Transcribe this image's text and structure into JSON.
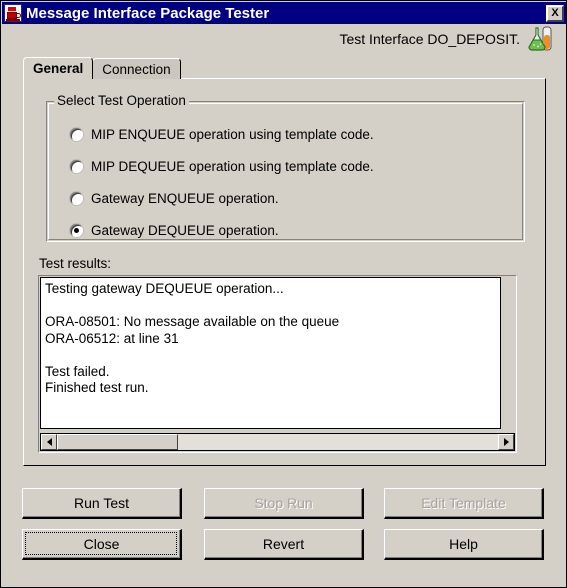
{
  "window": {
    "title": "Message Interface Package Tester",
    "icon": "java-coffee-cup-icon",
    "close_label": "X"
  },
  "header": {
    "interface_label": "Test Interface DO_DEPOSIT.",
    "icon": "flask-test-tube-icon"
  },
  "tabs": [
    {
      "label": "General",
      "selected": true
    },
    {
      "label": "Connection",
      "selected": false
    }
  ],
  "group": {
    "title": "Select Test Operation",
    "options": [
      {
        "label": "MIP ENQUEUE operation using template code.",
        "checked": false
      },
      {
        "label": "MIP DEQUEUE operation using template code.",
        "checked": false
      },
      {
        "label": "Gateway ENQUEUE operation.",
        "checked": false
      },
      {
        "label": "Gateway DEQUEUE operation.",
        "checked": true
      }
    ]
  },
  "results": {
    "label": "Test results:",
    "text": "Testing gateway DEQUEUE operation...\n\nORA-08501: No message available on the queue\nORA-06512: at line 31\n\nTest failed.\nFinished test run.",
    "scrollbar": {
      "left_arrow": "◄",
      "right_arrow": "►"
    }
  },
  "buttons": {
    "run_test": {
      "label": "Run Test",
      "disabled": false,
      "focused": false
    },
    "stop_run": {
      "label": "Stop Run",
      "disabled": true,
      "focused": false
    },
    "edit_template": {
      "label": "Edit Template",
      "disabled": true,
      "focused": false
    },
    "close": {
      "label": "Close",
      "disabled": false,
      "focused": true
    },
    "revert": {
      "label": "Revert",
      "disabled": false,
      "focused": false
    },
    "help": {
      "label": "Help",
      "disabled": false,
      "focused": false
    }
  },
  "colors": {
    "titlebar": "#000080",
    "face": "#d4d0c8",
    "text": "#000000",
    "disabled_text": "#a7a29b",
    "field_bg": "#ffffff"
  }
}
